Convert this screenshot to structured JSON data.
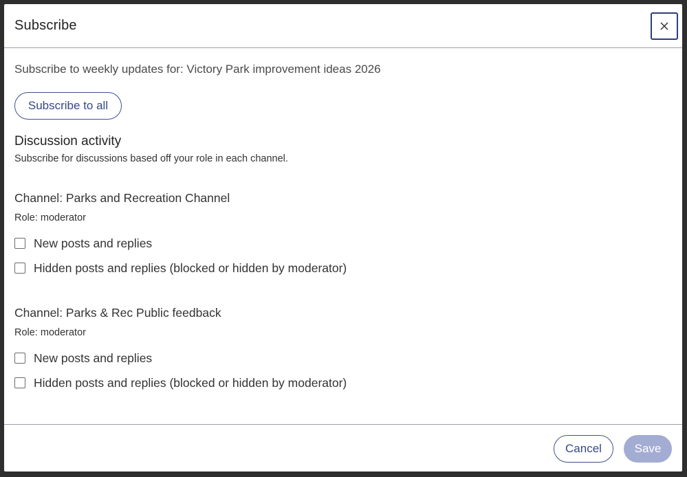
{
  "dialog": {
    "title": "Subscribe",
    "close_icon": "close-icon"
  },
  "body": {
    "intro_prefix": "Subscribe to weekly updates for: ",
    "project_title": "Victory Park improvement ideas 2026",
    "subscribe_all_label": "Subscribe to all",
    "section_heading": "Discussion activity",
    "section_subtitle": "Subscribe for discussions based off your role in each channel.",
    "channels": [
      {
        "name": "Channel: Parks and Recreation Channel",
        "role": "Role: moderator",
        "options": [
          {
            "label": "New posts and replies",
            "checked": false
          },
          {
            "label": "Hidden posts and replies (blocked or hidden by moderator)",
            "checked": false
          }
        ]
      },
      {
        "name": "Channel: Parks & Rec Public feedback",
        "role": "Role: moderator",
        "options": [
          {
            "label": "New posts and replies",
            "checked": false
          },
          {
            "label": "Hidden posts and replies (blocked or hidden by moderator)",
            "checked": false
          }
        ]
      }
    ]
  },
  "footer": {
    "cancel_label": "Cancel",
    "save_label": "Save",
    "save_disabled": true
  },
  "colors": {
    "accent": "#34488c",
    "save_disabled_bg": "#a3acd2",
    "divider": "#9aa0a6"
  }
}
